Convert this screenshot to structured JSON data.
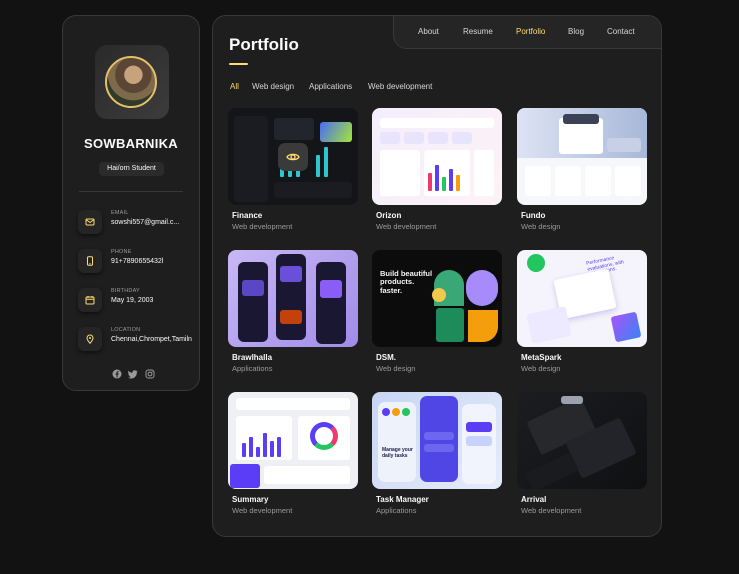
{
  "profile": {
    "name": "SOWBARNIKA",
    "title": "Hai/orn Student",
    "contacts": [
      {
        "label": "EMAIL",
        "value": "sowshi557@gmail.c...",
        "icon": "mail-icon"
      },
      {
        "label": "PHONE",
        "value": "91+7890655432l",
        "icon": "phone-icon"
      },
      {
        "label": "BIRTHDAY",
        "value": "May 19, 2003",
        "icon": "calendar-icon"
      },
      {
        "label": "LOCATION",
        "value": "Chennai,Chrompet,Tamiln",
        "icon": "location-icon"
      }
    ],
    "social": [
      "facebook-icon",
      "twitter-icon",
      "instagram-icon"
    ]
  },
  "nav": {
    "links": [
      "About",
      "Resume",
      "Portfolio",
      "Blog",
      "Contact"
    ],
    "active": "Portfolio"
  },
  "page": {
    "title": "Portfolio"
  },
  "filters": {
    "items": [
      "All",
      "Web design",
      "Applications",
      "Web development"
    ],
    "active": "All"
  },
  "projects": [
    {
      "title": "Finance",
      "category": "Web development"
    },
    {
      "title": "Orizon",
      "category": "Web development"
    },
    {
      "title": "Fundo",
      "category": "Web design"
    },
    {
      "title": "Brawlhalla",
      "category": "Applications"
    },
    {
      "title": "DSM.",
      "category": "Web design"
    },
    {
      "title": "MetaSpark",
      "category": "Web design"
    },
    {
      "title": "Summary",
      "category": "Web development"
    },
    {
      "title": "Task Manager",
      "category": "Applications"
    },
    {
      "title": "Arrival",
      "category": "Web development"
    }
  ],
  "thumb_text": {
    "dsm": "Build beautiful products. faster.",
    "metaspark": "Performance evaluations, with automations.",
    "task_manager": "Manage your daily tasks"
  },
  "colors": {
    "accent": "#ffdb70",
    "background": "#121212",
    "card": "#1e1e1f",
    "border": "#383838"
  }
}
